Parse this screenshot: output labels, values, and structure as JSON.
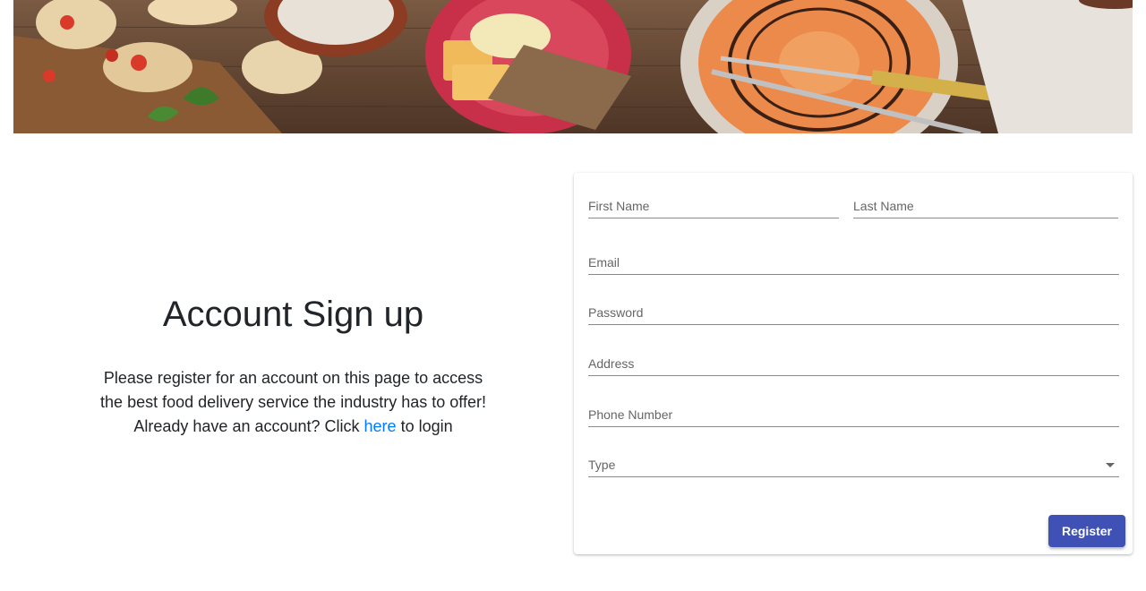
{
  "page": {
    "title": "Account Sign up",
    "description_line1": "Please register for an account on this page to access",
    "description_line2": "the best food delivery service the industry has to offer!",
    "login_prefix": "Already have an account? Click",
    "login_link": "here",
    "login_suffix": "to login"
  },
  "form": {
    "first_name_label": "First Name",
    "last_name_label": "Last Name",
    "email_label": "Email",
    "password_label": "Password",
    "address_label": "Address",
    "phone_label": "Phone Number",
    "type_label": "Type",
    "register_button": "Register"
  },
  "colors": {
    "accent": "#3f51b5",
    "link": "#007bff"
  },
  "icons": {
    "type_dropdown": "chevron-down-icon"
  }
}
